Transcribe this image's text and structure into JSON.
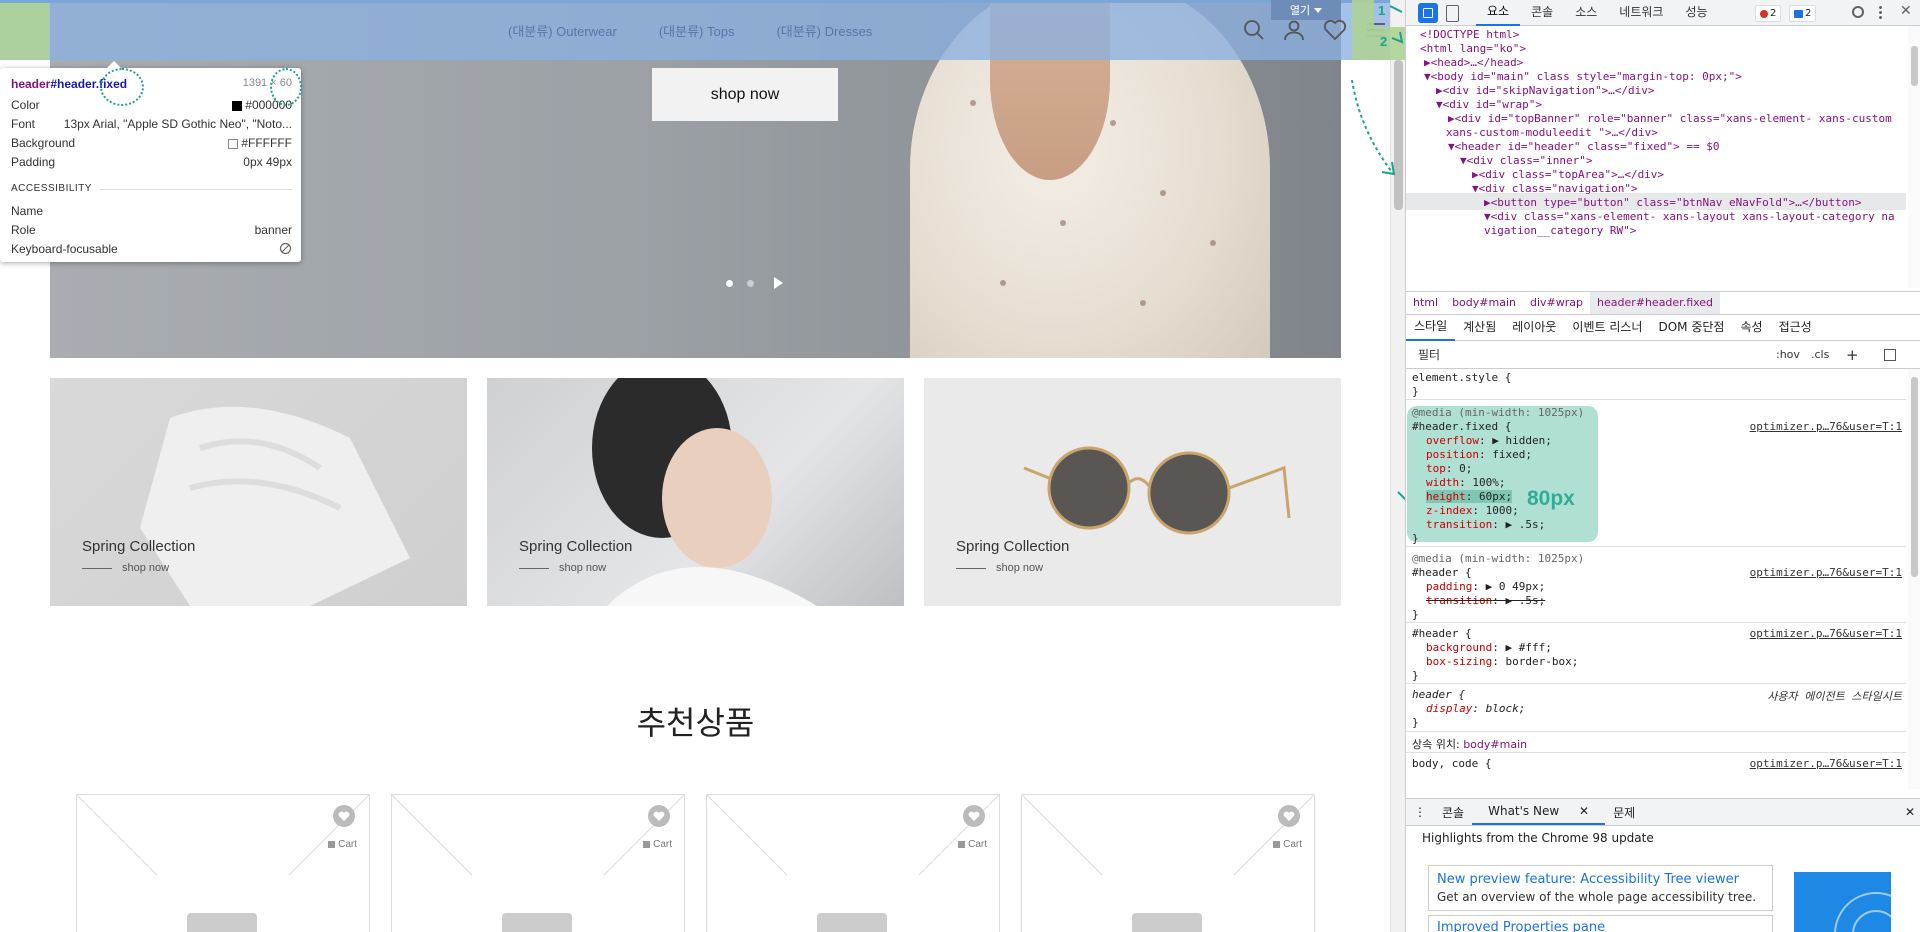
{
  "header": {
    "nav_items": [
      "(대분류) Outerwear",
      "(대분류) Tops",
      "(대분류) Dresses"
    ],
    "open_label": "열기"
  },
  "tooltip": {
    "selector_tag": "header",
    "selector_id": "#header",
    "selector_class": ".fixed",
    "dims_w": "1391",
    "dims_x": "×",
    "dims_h": "60",
    "rows": [
      {
        "k": "Color",
        "v": "#000000"
      },
      {
        "k": "Font",
        "v": "13px Arial, \"Apple SD Gothic Neo\", \"Noto..."
      },
      {
        "k": "Background",
        "v": "#FFFFFF"
      },
      {
        "k": "Padding",
        "v": "0px 49px"
      }
    ],
    "acc_title": "ACCESSIBILITY",
    "acc_rows": [
      {
        "k": "Name",
        "v": ""
      },
      {
        "k": "Role",
        "v": "banner"
      },
      {
        "k": "Keyboard-focusable",
        "v": ""
      }
    ]
  },
  "hero": {
    "button": "shop now"
  },
  "cards": [
    {
      "title": "Spring Collection",
      "sub": "shop now"
    },
    {
      "title": "Spring Collection",
      "sub": "shop now"
    },
    {
      "title": "Spring Collection",
      "sub": "shop now"
    }
  ],
  "section_title": "추천상품",
  "product_cart": "Cart",
  "devtools": {
    "tabs": [
      "요소",
      "콘솔",
      "소스",
      "네트워크",
      "성능"
    ],
    "error_count": "2",
    "msg_count": "2",
    "dom_lines": [
      "<!DOCTYPE html>",
      "<html lang=\"ko\">",
      "▶<head>…</head>",
      "▼<body id=\"main\" class style=\"margin-top: 0px;\">",
      "▶<div id=\"skipNavigation\">…</div>",
      "▼<div id=\"wrap\">",
      "▶<div id=\"topBanner\" role=\"banner\" class=\"xans-element- xans-custom",
      "xans-custom-moduleedit \">…</div>",
      "▼<header id=\"header\" class=\"fixed\"> == $0",
      "▼<div class=\"inner\">",
      "▶<div class=\"topArea\">…</div>",
      "▼<div class=\"navigation\">",
      "▶<button type=\"button\" class=\"btnNav eNavFold\">…</button>",
      "▼<div class=\"xans-element- xans-layout xans-layout-category na",
      "vigation__category RW\">"
    ],
    "breadcrumbs": [
      "html",
      "body#main",
      "div#wrap",
      "header#header.fixed"
    ],
    "sub_tabs": [
      "스타일",
      "계산됨",
      "레이아웃",
      "이벤트 리스너",
      "DOM 중단점",
      "속성",
      "접근성"
    ],
    "filter_placeholder": "필터",
    "filter_hov": ":hov",
    "filter_cls": ".cls",
    "styles": {
      "element_style": "element.style {",
      "close": "}",
      "media1": "@media (min-width: 1025px)",
      "rule1_sel": "#header.fixed {",
      "rule1_src": "optimizer.p…76&user=T:1",
      "rule1_props": [
        {
          "n": "overflow",
          "v": "▶ hidden;"
        },
        {
          "n": "position",
          "v": "fixed;"
        },
        {
          "n": "top",
          "v": "0;"
        },
        {
          "n": "width",
          "v": "100%;"
        },
        {
          "n": "height",
          "v": "60px;"
        },
        {
          "n": "z-index",
          "v": "1000;"
        },
        {
          "n": "transition",
          "v": "▶ .5s;"
        }
      ],
      "annotation": "80px",
      "media2": "@media (min-width: 1025px)",
      "rule2_sel": "#header {",
      "rule2_src": "optimizer.p…76&user=T:1",
      "rule2_props": [
        {
          "n": "padding",
          "v": "▶ 0 49px;"
        },
        {
          "n": "transition",
          "v": "▶ .5s;"
        }
      ],
      "rule3_sel": "#header {",
      "rule3_src": "optimizer.p…76&user=T:1",
      "rule3_props": [
        {
          "n": "background",
          "v": "▶ #fff;"
        },
        {
          "n": "box-sizing",
          "v": "border-box;"
        }
      ],
      "rule4_sel": "header {",
      "rule4_src": "사용자 에이전트 스타일시트",
      "rule4_props": [
        {
          "n": "display",
          "v": "block;"
        }
      ],
      "inherited_label": "상속 위치:",
      "inherited_from": "body#main",
      "rule5_sel": "body, code {",
      "rule5_src": "optimizer.p…76&user=T:1"
    },
    "drawer_tabs": [
      "콘솔",
      "What's New",
      "문제"
    ],
    "whatsnew_head": "Highlights from the Chrome 98 update",
    "feature_title": "New preview feature: Accessibility Tree viewer",
    "feature_desc": "Get an overview of the whole page accessibility tree.",
    "feature2_title": "Improved Properties pane"
  },
  "annotations": {
    "step1": "1",
    "step2": "2"
  },
  "colors": {
    "header_overlay": "#8cb0e0",
    "margin_overlay": "#aed396",
    "annotation": "#1aa38b",
    "devtools_accent": "#1a73e8"
  }
}
